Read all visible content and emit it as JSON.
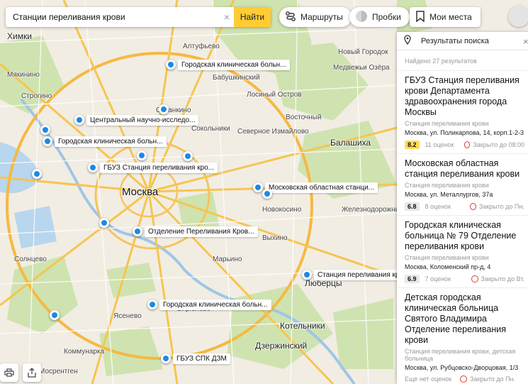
{
  "search": {
    "value": "Станции переливания крови",
    "find_label": "Найти",
    "clear_label": "×"
  },
  "toolbar": {
    "routes_label": "Маршруты",
    "traffic_label": "Пробки",
    "myplaces_label": "Мои места"
  },
  "map": {
    "places": [
      {
        "text": "Москва",
        "cls": "big"
      },
      {
        "text": "Химки",
        "cls": "mid"
      },
      {
        "text": "Балашиха",
        "cls": "mid"
      },
      {
        "text": "Люберцы",
        "cls": "mid"
      },
      {
        "text": "Котельники",
        "cls": "mid"
      },
      {
        "text": "Дзержинский",
        "cls": "mid"
      },
      {
        "text": "Мосрентген",
        "cls": ""
      },
      {
        "text": "Восточный",
        "cls": ""
      },
      {
        "text": "Новый Городок",
        "cls": ""
      },
      {
        "text": "Медвежьи Озёра",
        "cls": ""
      },
      {
        "text": "Железнодорожный",
        "cls": ""
      },
      {
        "text": "Новокосино",
        "cls": ""
      },
      {
        "text": "Северное Измайлово",
        "cls": ""
      },
      {
        "text": "Алтуфьево",
        "cls": ""
      },
      {
        "text": "Бабушкинский",
        "cls": ""
      },
      {
        "text": "Строгино",
        "cls": ""
      },
      {
        "text": "Сокольники",
        "cls": ""
      },
      {
        "text": "Марьино",
        "cls": ""
      },
      {
        "text": "Бирюлёво",
        "cls": ""
      },
      {
        "text": "Лосиный Остров",
        "cls": ""
      },
      {
        "text": "Мякинино",
        "cls": ""
      },
      {
        "text": "Солнцево",
        "cls": ""
      },
      {
        "text": "Ясенево",
        "cls": ""
      },
      {
        "text": "Коммунарка",
        "cls": ""
      },
      {
        "text": "Выхино",
        "cls": ""
      },
      {
        "text": "Останкино",
        "cls": ""
      }
    ],
    "pins": [
      {
        "label": "Городская клиническая больн..."
      },
      {
        "label": "Центральный научно-исследо..."
      },
      {
        "label": "Городская клиническая больн..."
      },
      {
        "label": "ГБУЗ Станция переливания кро..."
      },
      {
        "label": "Московская областная станци..."
      },
      {
        "label": "Отделение Переливания Кров..."
      },
      {
        "label": "Станция переливания крови"
      },
      {
        "label": "Городская клиническая больн..."
      },
      {
        "label": "ГБУЗ СПК ДЗМ"
      },
      {
        "label": ""
      },
      {
        "label": ""
      },
      {
        "label": ""
      },
      {
        "label": ""
      },
      {
        "label": ""
      },
      {
        "label": ""
      },
      {
        "label": ""
      },
      {
        "label": ""
      },
      {
        "label": ""
      }
    ]
  },
  "panel": {
    "title": "Результаты поиска",
    "close_label": "×",
    "found": "Найдено 27 результатов",
    "results": [
      {
        "title": "ГБУЗ Станция переливания крови Департамента здравоохранения города Москвы",
        "category": "Станция переливания крови",
        "address": "Москва, ул. Поликарпова, 14, корп.1-2-3",
        "rating": "8.2",
        "reviews": "11 оценок",
        "hours": "Закрыто до 08:00"
      },
      {
        "title": "Московская областная станция переливания крови",
        "category": "Станция переливания крови",
        "address": "Москва, ул. Металлургов, 37а",
        "rating": "6.8",
        "reviews": "8 оценок",
        "hours": "Закрыто до Пн."
      },
      {
        "title": "Городская клиническая больница № 79 Отделение переливания крови",
        "category": "Станция переливания крови",
        "address": "Москва, Коломенский пр-д, 4",
        "rating": "6.9",
        "reviews": "7 оценок",
        "hours": "Закрыто до Вт."
      },
      {
        "title": "Детская городская клиническая больница Святого Владимира Отделение переливания крови",
        "category": "Станция переливания крови, детская больница",
        "address": "Москва, ул. Рубцовско-Дворцовая, 1/3",
        "rating": "",
        "reviews": "Еще нет оценок",
        "hours": "Закрыто до Пн."
      }
    ]
  },
  "colors": {
    "accent": "#ffcc33",
    "pin": "#1e88e5",
    "rating_high": "#ffdd55",
    "rating_mid": "#e8e8e8",
    "closed": "#e53935"
  }
}
